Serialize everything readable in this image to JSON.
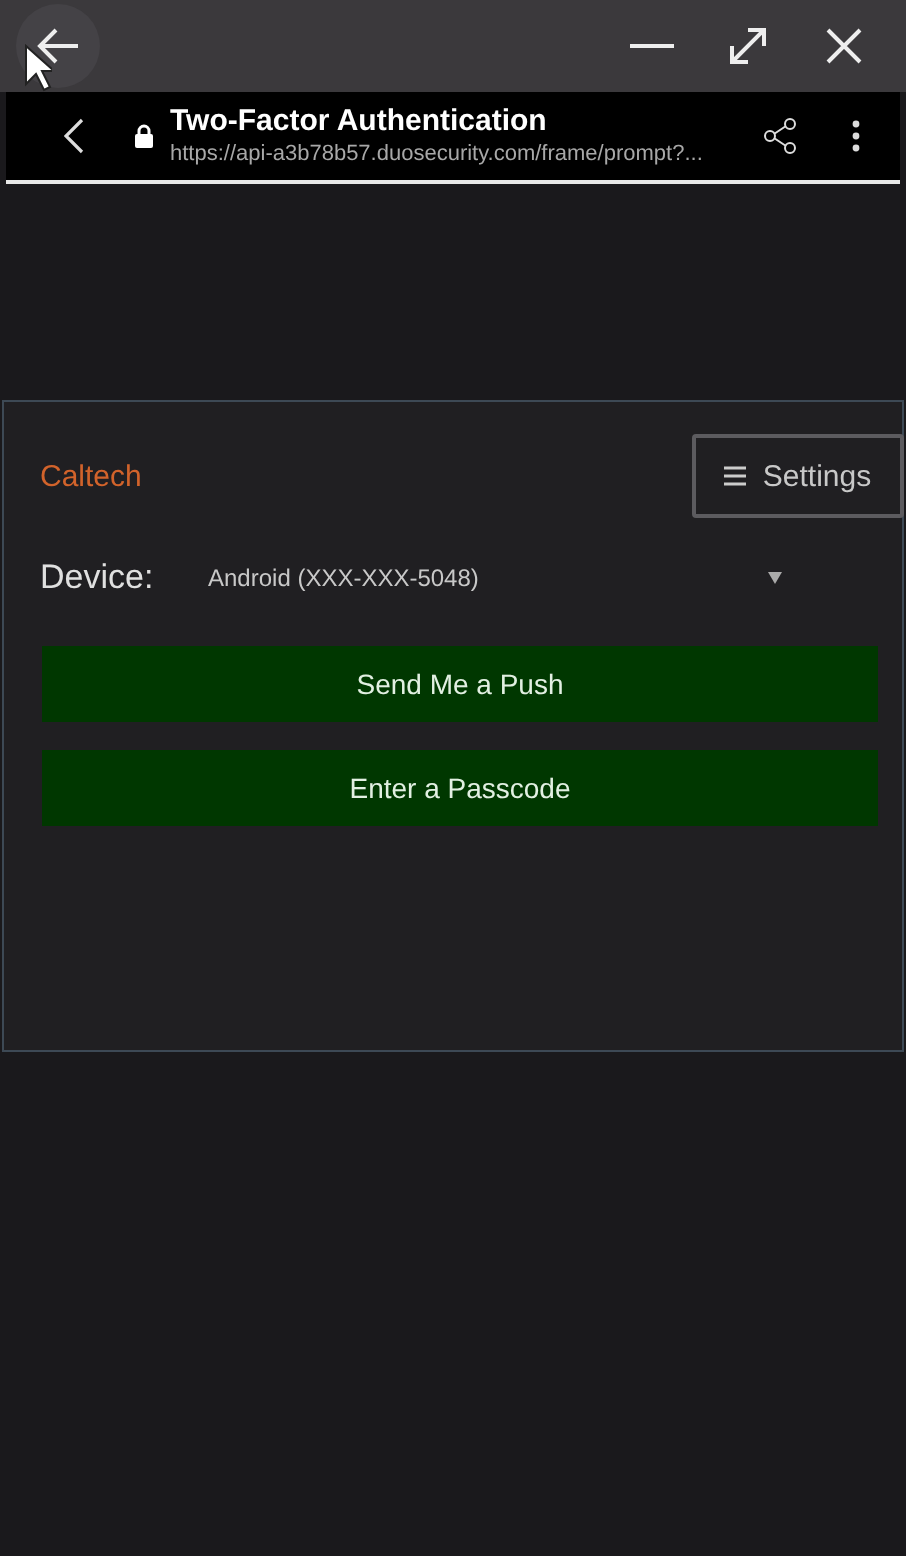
{
  "browser": {
    "title": "Two-Factor Authentication",
    "url": "https://api-a3b78b57.duosecurity.com/frame/prompt?..."
  },
  "panel": {
    "brand": "Caltech",
    "settings_button": "Settings",
    "device_label": "Device:",
    "device_value": "Android (XXX-XXX-5048)",
    "actions": [
      "Send Me a Push",
      "Enter a Passcode"
    ]
  }
}
